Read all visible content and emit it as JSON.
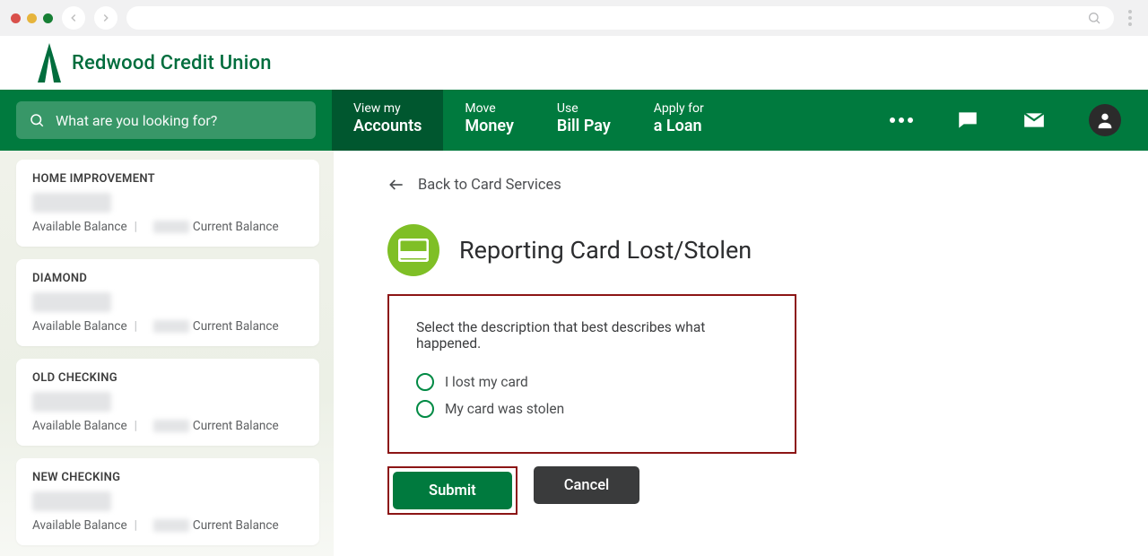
{
  "brand": {
    "name": "Redwood Credit Union"
  },
  "search": {
    "placeholder": "What are you looking for?"
  },
  "nav": {
    "accounts_small": "View my",
    "accounts_big": "Accounts",
    "money_small": "Move",
    "money_big": "Money",
    "billpay_small": "Use",
    "billpay_big": "Bill Pay",
    "loan_small": "Apply for",
    "loan_big": "a Loan"
  },
  "accounts": [
    {
      "title": "HOME IMPROVEMENT",
      "avail_label": "Available Balance",
      "curr_label": "Current Balance"
    },
    {
      "title": "DIAMOND",
      "avail_label": "Available Balance",
      "curr_label": "Current Balance"
    },
    {
      "title": "OLD CHECKING",
      "avail_label": "Available Balance",
      "curr_label": "Current Balance"
    },
    {
      "title": "NEW CHECKING",
      "avail_label": "Available Balance",
      "curr_label": "Current Balance"
    }
  ],
  "main": {
    "back_label": "Back to Card Services",
    "page_title": "Reporting Card Lost/Stolen",
    "prompt": "Select the description that best describes what happened.",
    "option_lost": "I lost my card",
    "option_stolen": "My card was stolen",
    "submit_label": "Submit",
    "cancel_label": "Cancel"
  },
  "colors": {
    "green": "#007a3e",
    "green_dark": "#00572f",
    "lime": "#7fbf26",
    "accent_red": "#8c1515"
  }
}
